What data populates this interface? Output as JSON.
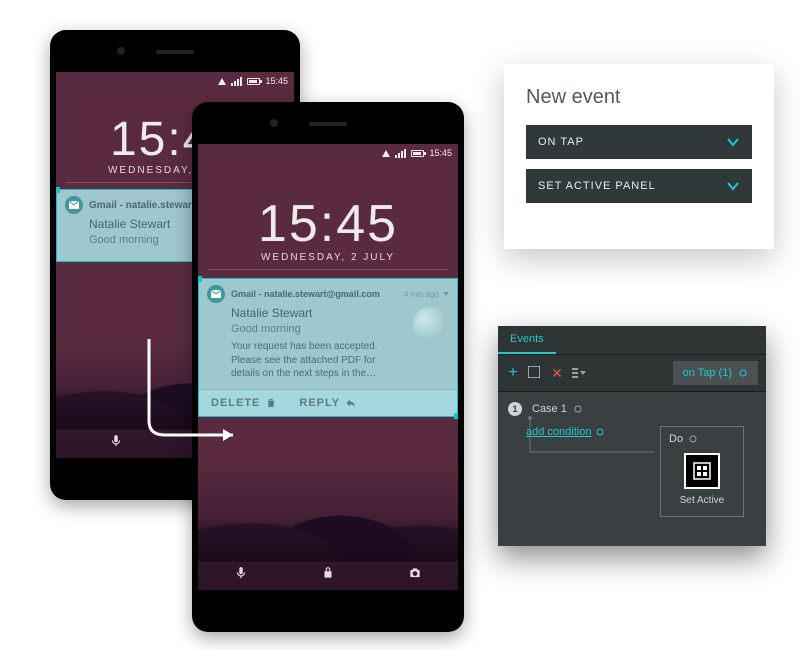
{
  "status": {
    "time": "15:45"
  },
  "lock": {
    "time": "15:45",
    "date": "WEDNESDAY, 2 JULY"
  },
  "notif_small": {
    "sender": "Gmail - natalie.stewart...",
    "name": "Natalie Stewart",
    "subject": "Good morning"
  },
  "notif_big": {
    "sender": "Gmail - natalie.stewart@gmail.com",
    "meta": "4 min ago",
    "name": "Natalie Stewart",
    "subject": "Good morning",
    "body": "Your request has been accepted. Please see the attached PDF for details on the next steps in the…",
    "delete_label": "DELETE",
    "reply_label": "REPLY"
  },
  "newevent": {
    "title": "New event",
    "trigger": "ON TAP",
    "action": "SET ACTIVE PANEL"
  },
  "events": {
    "tab": "Events",
    "active_event": "on Tap (1)",
    "case_label": "Case 1",
    "case_num": "1",
    "add_condition": "add condition",
    "do_label": "Do",
    "action_label": "Set Active"
  }
}
